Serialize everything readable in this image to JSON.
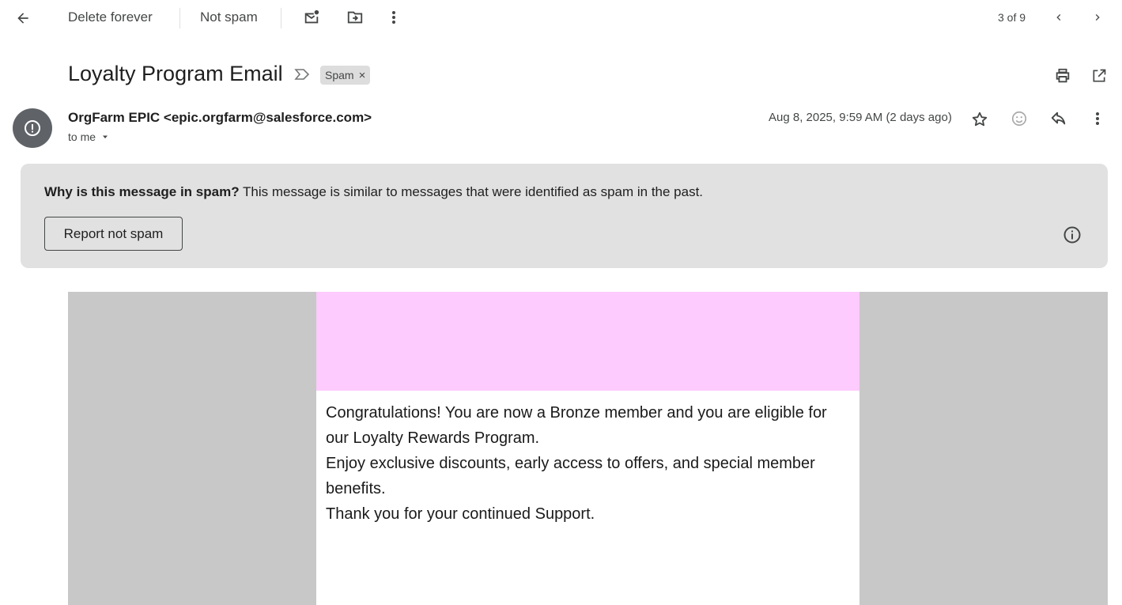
{
  "toolbar": {
    "delete_forever": "Delete forever",
    "not_spam": "Not spam",
    "pagination": "3 of 9"
  },
  "message": {
    "subject": "Loyalty Program Email",
    "label_chip": "Spam",
    "sender": "OrgFarm EPIC <epic.orgfarm@salesforce.com>",
    "recipient": "to me",
    "date": "Aug 8, 2025, 9:59 AM (2 days ago)"
  },
  "spam_banner": {
    "question": "Why is this message in spam?",
    "explanation": "This message is similar to messages that were identified as spam in the past.",
    "report_button": "Report not spam"
  },
  "email_content": {
    "paragraphs": [
      "Congratulations! You are now a Bronze member and you are eligible for our Loyalty Rewards Program.",
      "Enjoy exclusive discounts, early access to offers, and special member benefits.",
      "Thank you for your continued Support."
    ],
    "header_color": "#fdcbfd",
    "frame_color": "#c8c8c8"
  },
  "icons": {
    "back": "arrow-left-icon",
    "mark_unread": "mail-unread-icon",
    "move_to": "folder-move-icon",
    "more": "more-vertical-icon",
    "prev": "chevron-left-icon",
    "next": "chevron-right-icon",
    "important": "importance-marker-icon",
    "print": "print-icon",
    "new_window": "open-in-new-icon",
    "avatar": "spam-avatar-icon",
    "star": "star-icon",
    "emoji": "emoji-reaction-icon",
    "reply": "reply-icon",
    "info": "info-icon"
  }
}
